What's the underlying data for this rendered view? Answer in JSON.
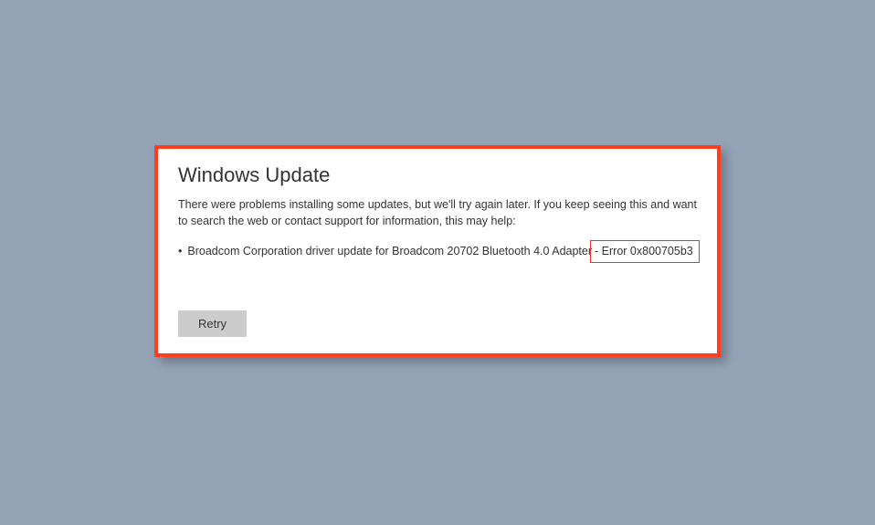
{
  "dialog": {
    "title": "Windows Update",
    "message": "There were problems installing some updates, but we'll try again later. If you keep seeing this and want to search the web or contact support for information, this may help:",
    "updates": [
      {
        "name": "Broadcom Corporation driver update for Broadcom 20702 Bluetooth 4.0 Adapter",
        "error_label": " - Error 0x800705b3"
      }
    ],
    "retry_label": "Retry"
  }
}
